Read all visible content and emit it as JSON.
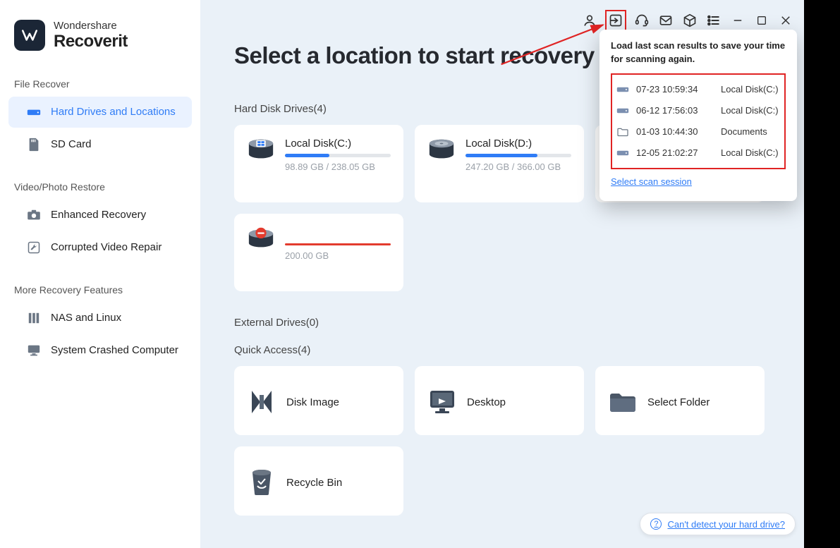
{
  "brand": {
    "line1": "Wondershare",
    "line2": "Recoverit"
  },
  "sidebar": {
    "section1_title": "File Recover",
    "items1": [
      {
        "label": "Hard Drives and Locations",
        "active": true,
        "icon": "hdd"
      },
      {
        "label": "SD Card",
        "active": false,
        "icon": "sdcard"
      }
    ],
    "section2_title": "Video/Photo Restore",
    "items2": [
      {
        "label": "Enhanced Recovery",
        "icon": "camera"
      },
      {
        "label": "Corrupted Video Repair",
        "icon": "wrench"
      }
    ],
    "section3_title": "More Recovery Features",
    "items3": [
      {
        "label": "NAS and Linux",
        "icon": "server"
      },
      {
        "label": "System Crashed Computer",
        "icon": "monitor"
      }
    ]
  },
  "main": {
    "title": "Select a location to start recovery",
    "hdd_heading": "Hard Disk Drives(4)",
    "external_heading": "External Drives(0)",
    "quick_heading": "Quick Access(4)",
    "drives": [
      {
        "name": "Local Disk(C:)",
        "used": "98.89 GB / 238.05 GB",
        "fill_pct": 42,
        "type": "win"
      },
      {
        "name": "Local Disk(D:)",
        "used": "247.20 GB / 366.00 GB",
        "fill_pct": 68,
        "type": "hdd"
      },
      {
        "name": "",
        "used": "",
        "fill_pct": 0,
        "type": "hdd",
        "hidden_card": true
      }
    ],
    "drive_lost": {
      "name": "",
      "used": "200.00 GB",
      "fill_pct": 100,
      "type": "lost"
    },
    "quick": [
      {
        "label": "Disk Image",
        "icon": "diskimage"
      },
      {
        "label": "Desktop",
        "icon": "desktop"
      },
      {
        "label": "Select Folder",
        "icon": "folder"
      },
      {
        "label": "Recycle Bin",
        "icon": "trash"
      }
    ]
  },
  "popup": {
    "desc": "Load last scan results to save your time for scanning again.",
    "rows": [
      {
        "time": "07-23  10:59:34",
        "location": "Local Disk(C:)",
        "icon": "hdd"
      },
      {
        "time": "06-12  17:56:03",
        "location": "Local Disk(C:)",
        "icon": "hdd"
      },
      {
        "time": "01-03  10:44:30",
        "location": "Documents",
        "icon": "folder"
      },
      {
        "time": "12-05  21:02:27",
        "location": "Local Disk(C:)",
        "icon": "hdd"
      }
    ],
    "link": "Select scan session"
  },
  "help_link": "Can't detect your hard drive?"
}
